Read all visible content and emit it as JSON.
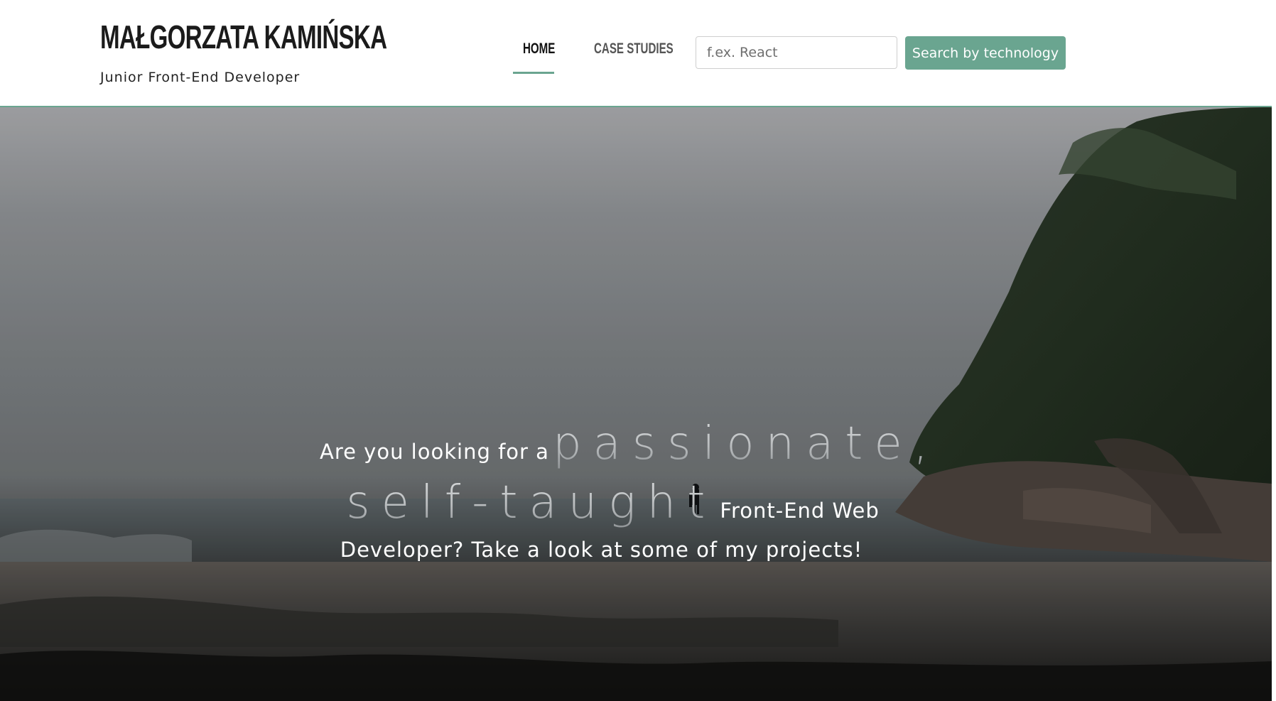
{
  "header": {
    "brand_name": "MAŁGORZATA KAMIŃSKA",
    "brand_subtitle": "Junior Front-End Developer",
    "nav": [
      {
        "label": "HOME",
        "active": true
      },
      {
        "label": "CASE STUDIES",
        "active": false
      }
    ],
    "search": {
      "placeholder": "f.ex. React",
      "value": "",
      "button_label": "Search by technology"
    }
  },
  "hero": {
    "text_line1_prefix": "Are you looking for a",
    "text_line1_emphasis": "passionate,",
    "text_line2_emphasis": "self-taught",
    "text_line2_suffix": "Front-End Web",
    "text_line3": "Developer? Take a look at some of my projects!"
  },
  "colors": {
    "accent": "#6aa590",
    "text_dark": "#1b1b1b",
    "hero_text": "#ffffff"
  }
}
